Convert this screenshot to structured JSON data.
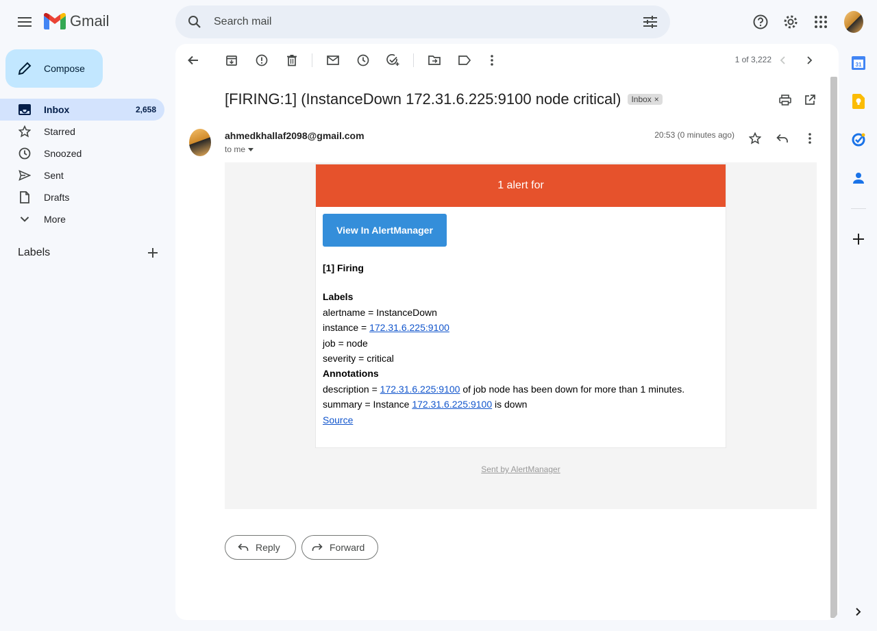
{
  "app": {
    "name": "Gmail"
  },
  "search": {
    "placeholder": "Search mail"
  },
  "sidebar": {
    "compose_label": "Compose",
    "items": [
      {
        "label": "Inbox",
        "count": "2,658",
        "icon": "inbox-icon"
      },
      {
        "label": "Starred",
        "count": "",
        "icon": "star-icon"
      },
      {
        "label": "Snoozed",
        "count": "",
        "icon": "clock-icon"
      },
      {
        "label": "Sent",
        "count": "",
        "icon": "send-icon"
      },
      {
        "label": "Drafts",
        "count": "",
        "icon": "draft-icon"
      },
      {
        "label": "More",
        "count": "",
        "icon": "chevron-down-icon"
      }
    ],
    "labels_title": "Labels"
  },
  "toolbar": {
    "pager": "1 of 3,222"
  },
  "message": {
    "subject": "[FIRING:1] (InstanceDown 172.31.6.225:9100 node critical)",
    "chip": "Inbox",
    "chip_close": "×",
    "sender": "ahmedkhallaf2098@gmail.com",
    "to": "to me",
    "timestamp": "20:53 (0 minutes ago)"
  },
  "email": {
    "header": "1 alert for",
    "button": "View In AlertManager",
    "firing": "[1] Firing",
    "labels_heading": "Labels",
    "alertname": "alertname = InstanceDown",
    "instance_prefix": "instance = ",
    "instance_link": "172.31.6.225:9100",
    "job": "job = node",
    "severity": "severity = critical",
    "annotations_heading": "Annotations",
    "desc_prefix": "description = ",
    "desc_link": "172.31.6.225:9100",
    "desc_suffix": " of job node has been down for more than 1 minutes.",
    "summary_prefix": "summary = Instance ",
    "summary_link": "172.31.6.225:9100",
    "summary_suffix": " is down",
    "source": "Source",
    "footer": "Sent by AlertManager"
  },
  "actions": {
    "reply": "Reply",
    "forward": "Forward"
  },
  "colors": {
    "alert_header": "#e6522c",
    "alert_button": "#348eda",
    "nav_active": "#d3e3fd",
    "compose": "#c2e7ff"
  }
}
